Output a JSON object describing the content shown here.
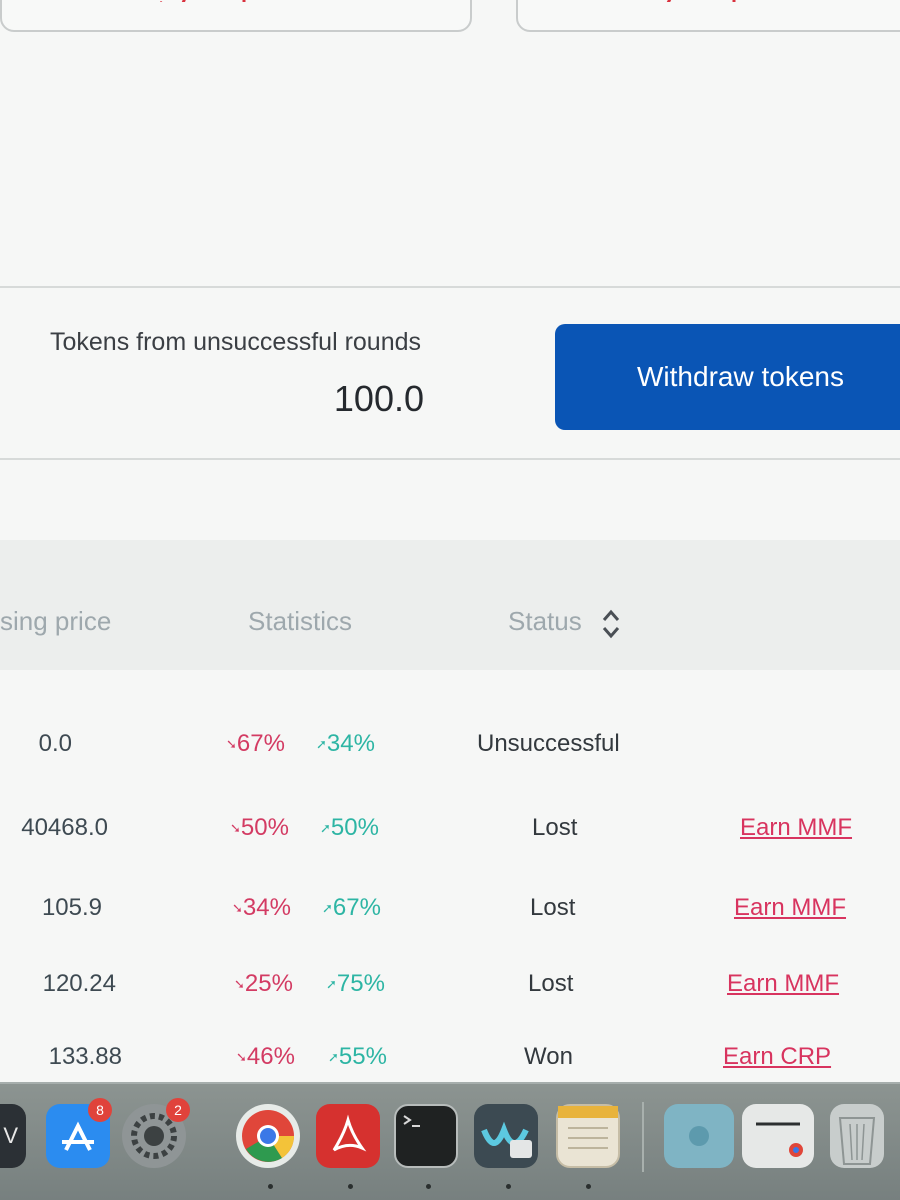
{
  "tokens_panel": {
    "label": "Tokens from unsuccessful rounds",
    "value": "100.0",
    "withdraw_button": "Withdraw tokens"
  },
  "table": {
    "headers": {
      "closing_price": "sing price",
      "statistics": "Statistics",
      "status": "Status"
    },
    "rows": [
      {
        "price": "0.0",
        "down": "67%",
        "up": "34%",
        "status": "Unsuccessful",
        "action": ""
      },
      {
        "price": "40468.0",
        "down": "50%",
        "up": "50%",
        "status": "Lost",
        "action": "Earn MMF"
      },
      {
        "price": "105.9",
        "down": "34%",
        "up": "67%",
        "status": "Lost",
        "action": "Earn MMF"
      },
      {
        "price": "120.24",
        "down": "25%",
        "up": "75%",
        "status": "Lost",
        "action": "Earn MMF"
      },
      {
        "price": "133.88",
        "down": "46%",
        "up": "55%",
        "status": "Won",
        "action": "Earn CRP"
      }
    ]
  },
  "dock": {
    "app_store_badge": "8",
    "settings_badge": "2",
    "tv_label": "V"
  },
  "colors": {
    "primary_button": "#0a55b5",
    "down_red": "#d33b63",
    "up_green": "#2db5a4",
    "link_red": "#d8345f"
  }
}
